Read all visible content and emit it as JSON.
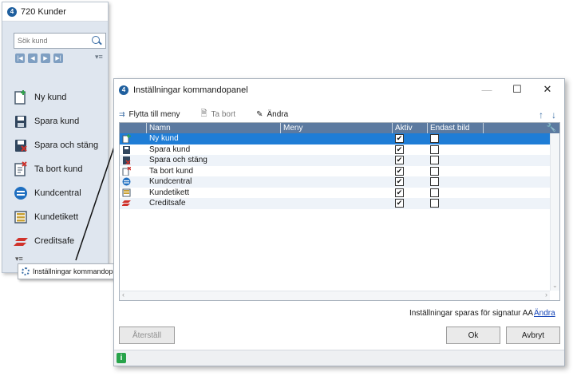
{
  "left_panel": {
    "title": "720 Kunder",
    "search_placeholder": "Sök kund",
    "nav_buttons": [
      "first-icon",
      "prev-icon",
      "next-icon",
      "last-icon"
    ],
    "commands": [
      {
        "label": "Ny kund",
        "icon": "new-customer-icon"
      },
      {
        "label": "Spara kund",
        "icon": "save-icon"
      },
      {
        "label": "Spara och stäng",
        "icon": "save-close-icon"
      },
      {
        "label": "Ta bort kund",
        "icon": "delete-customer-icon"
      },
      {
        "label": "Kundcentral",
        "icon": "customer-central-icon"
      },
      {
        "label": "Kundetikett",
        "icon": "label-icon"
      },
      {
        "label": "Creditsafe",
        "icon": "creditsafe-icon"
      }
    ]
  },
  "context_menu": {
    "item": "Inställningar kommandopanel"
  },
  "dialog": {
    "title": "Inställningar kommandopanel",
    "toolbar": {
      "move_to_menu": "Flytta till meny",
      "remove": "Ta bort",
      "edit": "Ändra"
    },
    "columns": [
      "Namn",
      "Meny",
      "Aktiv",
      "Endast bild"
    ],
    "rows": [
      {
        "name": "Ny kund",
        "menu": "",
        "active": true,
        "image_only": false,
        "selected": true
      },
      {
        "name": "Spara kund",
        "menu": "",
        "active": true,
        "image_only": false
      },
      {
        "name": "Spara och stäng",
        "menu": "",
        "active": true,
        "image_only": false
      },
      {
        "name": "Ta bort kund",
        "menu": "",
        "active": true,
        "image_only": false
      },
      {
        "name": "Kundcentral",
        "menu": "",
        "active": true,
        "image_only": false
      },
      {
        "name": "Kundetikett",
        "menu": "",
        "active": true,
        "image_only": false
      },
      {
        "name": "Creditsafe",
        "menu": "",
        "active": true,
        "image_only": false
      }
    ],
    "signature_text": "Inställningar sparas för signatur AA",
    "signature_link": "Ändra",
    "buttons": {
      "reset": "Återställ",
      "ok": "Ok",
      "cancel": "Avbryt"
    }
  },
  "colors": {
    "header": "#5c7aa0",
    "selected_row": "#1f7dd6",
    "panel_bg": "#dfe6ef"
  }
}
